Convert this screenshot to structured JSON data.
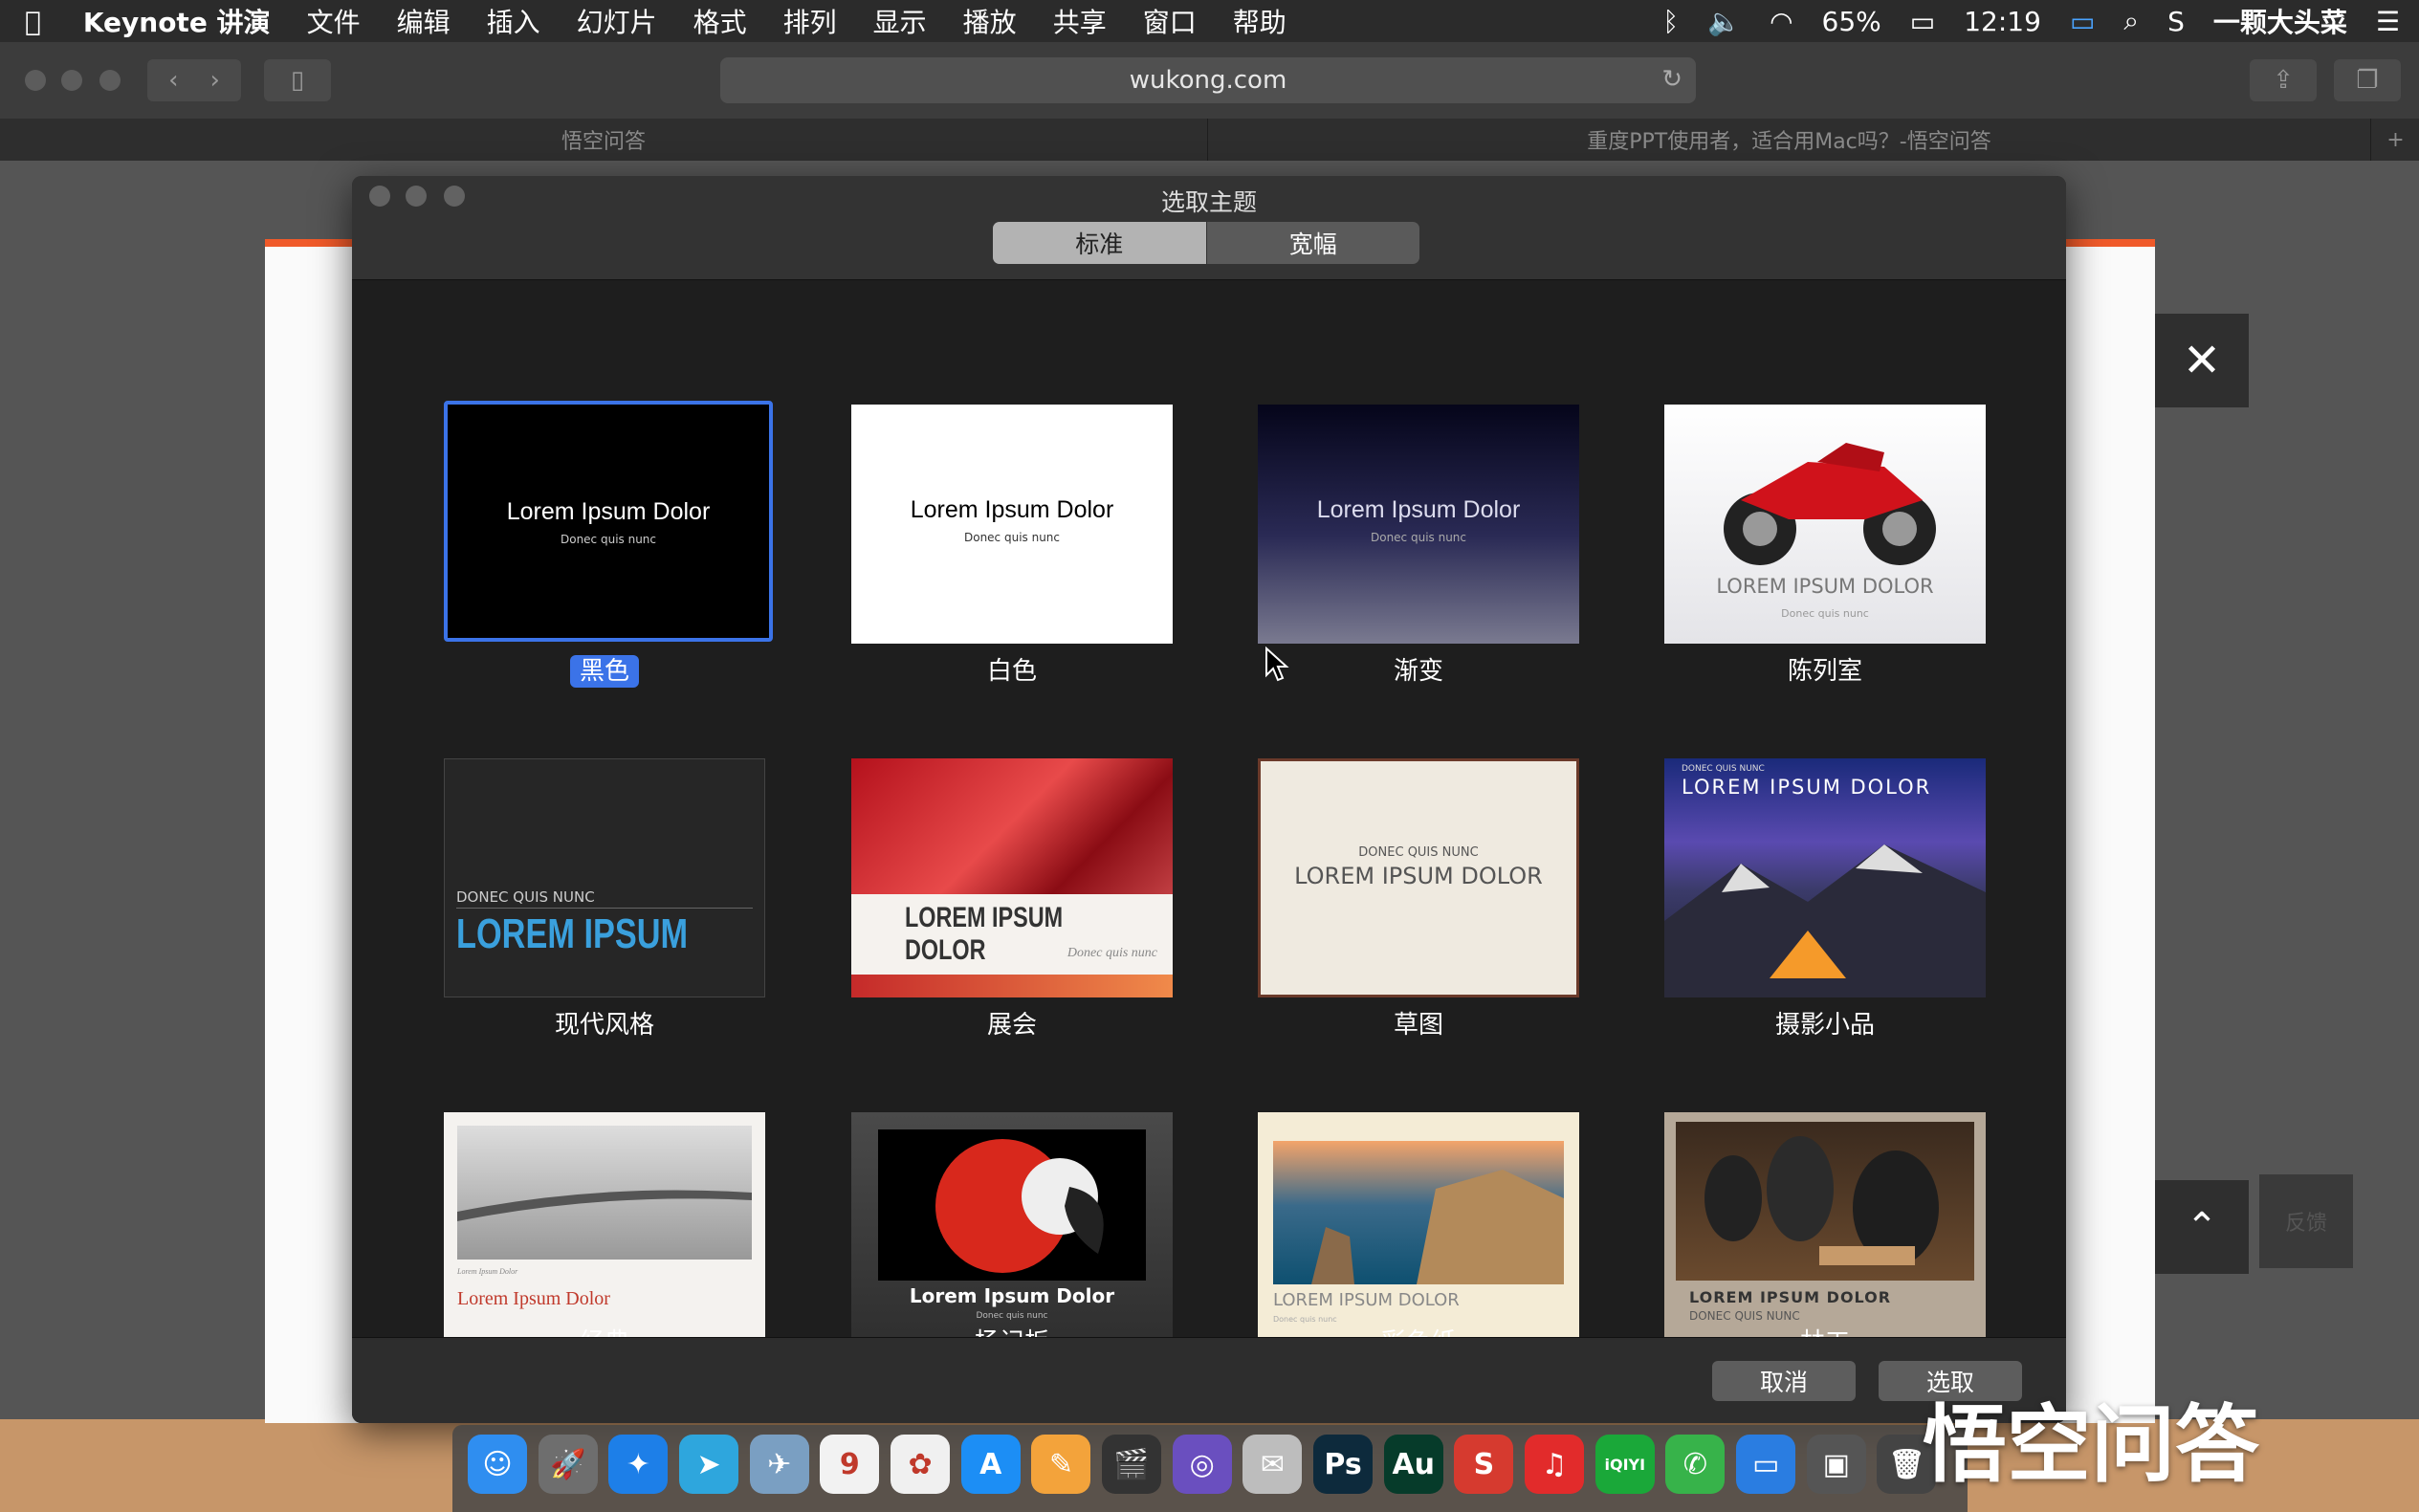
{
  "menubar": {
    "app_name": "Keynote 讲演",
    "items": [
      "文件",
      "编辑",
      "插入",
      "幻灯片",
      "格式",
      "排列",
      "显示",
      "播放",
      "共享",
      "窗口",
      "帮助"
    ],
    "battery": "65%",
    "time": "12:19",
    "user": "一颗大头菜"
  },
  "browser": {
    "url": "wukong.com",
    "tabs": [
      "悟空问答",
      "重度PPT使用者，适合用Mac吗？-悟空问答"
    ]
  },
  "dialog": {
    "title": "选取主题",
    "segments": [
      "标准",
      "宽幅"
    ],
    "selected_segment": "标准",
    "cancel_label": "取消",
    "choose_label": "选取",
    "themes": [
      {
        "name": "黑色",
        "title": "Lorem Ipsum Dolor",
        "subtitle": "Donec quis nunc",
        "selected": true
      },
      {
        "name": "白色",
        "title": "Lorem Ipsum Dolor",
        "subtitle": "Donec quis nunc"
      },
      {
        "name": "渐变",
        "title": "Lorem Ipsum Dolor",
        "subtitle": "Donec quis nunc"
      },
      {
        "name": "陈列室",
        "title": "LOREM IPSUM DOLOR",
        "subtitle": "Donec quis nunc"
      },
      {
        "name": "现代风格",
        "title": "LOREM IPSUM",
        "subtitle": "DONEC QUIS NUNC"
      },
      {
        "name": "展会",
        "title": "LOREM IPSUM DOLOR",
        "subtitle": "Donec quis nunc"
      },
      {
        "name": "草图",
        "title": "LOREM IPSUM DOLOR",
        "subtitle": "DONEC QUIS NUNC"
      },
      {
        "name": "摄影小品",
        "title": "LOREM IPSUM DOLOR",
        "subtitle": "DONEC QUIS NUNC"
      },
      {
        "name": "经典",
        "title": "Lorem Ipsum Dolor",
        "subtitle": "Lorem Ipsum Dolor"
      },
      {
        "name": "杨记板",
        "title": "Lorem Ipsum Dolor",
        "subtitle": "Donec quis nunc"
      },
      {
        "name": "彩色纸",
        "title": "LOREM IPSUM DOLOR",
        "subtitle": "Donec quis nunc"
      },
      {
        "name": "林工",
        "title": "LOREM IPSUM DOLOR",
        "subtitle": "DONEC QUIS NUNC"
      }
    ]
  },
  "overlay": {
    "close_glyph": "✕",
    "up_glyph": "⌃",
    "fade_text": "反馈"
  },
  "dock": {
    "apps": [
      {
        "name": "finder",
        "label": "☺",
        "color": "#2f8ef0"
      },
      {
        "name": "launchpad",
        "label": "🚀",
        "color": "#6e6e6e"
      },
      {
        "name": "safari",
        "label": "✦",
        "color": "#1d7fe8"
      },
      {
        "name": "telegram",
        "label": "➤",
        "color": "#2ea6dd"
      },
      {
        "name": "preview",
        "label": "✈",
        "color": "#7a9fc2"
      },
      {
        "name": "calendar",
        "label": "9",
        "color": "#f2f2f2"
      },
      {
        "name": "photos",
        "label": "✿",
        "color": "#f0f0f0"
      },
      {
        "name": "app-store",
        "label": "A",
        "color": "#1c8ef5"
      },
      {
        "name": "pages",
        "label": "✎",
        "color": "#f3a33b"
      },
      {
        "name": "final-cut",
        "label": "🎬",
        "color": "#333333"
      },
      {
        "name": "motion",
        "label": "◎",
        "color": "#6a4fbf"
      },
      {
        "name": "mail",
        "label": "✉",
        "color": "#bdbdbd"
      },
      {
        "name": "photoshop",
        "label": "Ps",
        "color": "#0d2a3c"
      },
      {
        "name": "audition",
        "label": "Au",
        "color": "#063b2a"
      },
      {
        "name": "sketchup",
        "label": "S",
        "color": "#d63a2f"
      },
      {
        "name": "netease-music",
        "label": "♫",
        "color": "#e22b2b"
      },
      {
        "name": "iqiyi",
        "label": "iQIYI",
        "color": "#1aa839"
      },
      {
        "name": "wechat",
        "label": "✆",
        "color": "#37b34a"
      },
      {
        "name": "keynote",
        "label": "▭",
        "color": "#2a7de1"
      },
      {
        "name": "system-info",
        "label": "▣",
        "color": "#555555"
      },
      {
        "name": "trash",
        "label": "🗑",
        "color": "#444444"
      }
    ]
  },
  "watermark": "悟空问答",
  "colors": {
    "accent": "#3b73e8",
    "brand": "#f05a2a"
  }
}
